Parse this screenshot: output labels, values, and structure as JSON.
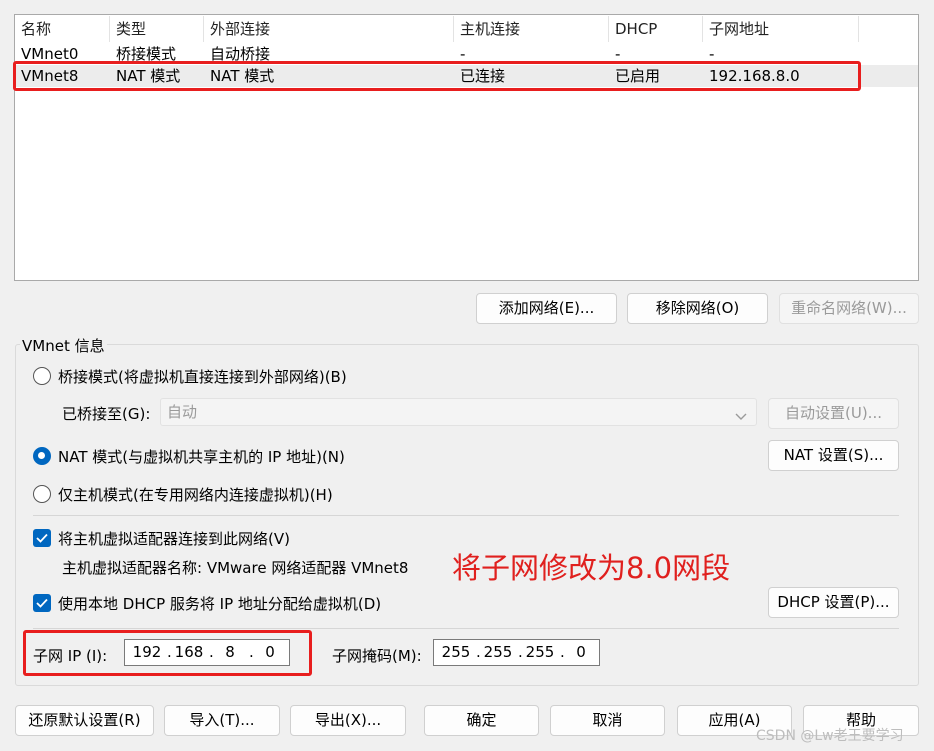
{
  "table": {
    "headers": [
      "名称",
      "类型",
      "外部连接",
      "主机连接",
      "DHCP",
      "子网地址"
    ],
    "rows": [
      [
        "VMnet0",
        "桥接模式",
        "自动桥接",
        "-",
        "-",
        "-"
      ],
      [
        "VMnet8",
        "NAT 模式",
        "NAT 模式",
        "已连接",
        "已启用",
        "192.168.8.0"
      ]
    ],
    "selected_row": 1
  },
  "table_buttons": {
    "add": "添加网络(E)...",
    "remove": "移除网络(O)",
    "rename": "重命名网络(W)..."
  },
  "vmnet_info": {
    "title": "VMnet 信息",
    "bridged_mode": "桥接模式(将虚拟机直接连接到外部网络)(B)",
    "bridged_to_label": "已桥接至(G):",
    "bridged_to_value": "自动",
    "auto_settings": "自动设置(U)...",
    "nat_mode": "NAT 模式(与虚拟机共享主机的 IP 地址)(N)",
    "nat_settings": "NAT 设置(S)...",
    "host_only_mode": "仅主机模式(在专用网络内连接虚拟机)(H)",
    "selected_mode": "nat",
    "connect_adapter": "将主机虚拟适配器连接到此网络(V)",
    "connect_adapter_checked": true,
    "adapter_name": "主机虚拟适配器名称: VMware 网络适配器 VMnet8",
    "use_dhcp": "使用本地 DHCP 服务将 IP 地址分配给虚拟机(D)",
    "use_dhcp_checked": true,
    "dhcp_settings": "DHCP 设置(P)...",
    "subnet_ip_label": "子网 IP (I):",
    "subnet_ip": [
      "192",
      "168",
      "8",
      "0"
    ],
    "subnet_mask_label": "子网掩码(M):",
    "subnet_mask": [
      "255",
      "255",
      "255",
      "0"
    ]
  },
  "annotation": "将子网修改为8.0网段",
  "footer_buttons": {
    "restore_defaults": "还原默认设置(R)",
    "import": "导入(T)...",
    "export": "导出(X)...",
    "ok": "确定",
    "cancel": "取消",
    "apply": "应用(A)",
    "help": "帮助"
  },
  "watermark": "CSDN @Lw老王要学习",
  "colors": {
    "accent": "#0067c0",
    "highlight_red": "#e81e1e",
    "selected_row": "#ececec"
  }
}
